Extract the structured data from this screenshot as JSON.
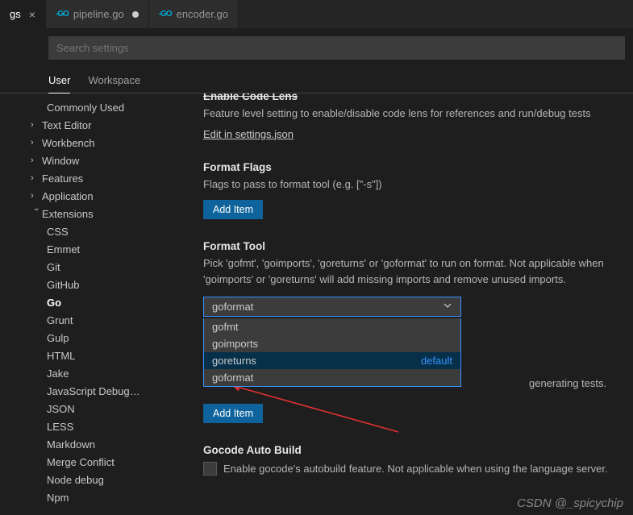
{
  "tabs": {
    "settings": "gs",
    "pipeline": "pipeline.go",
    "encoder": "encoder.go"
  },
  "search": {
    "placeholder": "Search settings"
  },
  "scope": {
    "user": "User",
    "workspace": "Workspace"
  },
  "sidebar": {
    "commonly_used": "Commonly Used",
    "text_editor": "Text Editor",
    "workbench": "Workbench",
    "window": "Window",
    "features": "Features",
    "application": "Application",
    "extensions": "Extensions",
    "items": [
      "CSS",
      "Emmet",
      "Git",
      "GitHub",
      "Go",
      "Grunt",
      "Gulp",
      "HTML",
      "Jake",
      "JavaScript Debug…",
      "JSON",
      "LESS",
      "Markdown",
      "Merge Conflict",
      "Node debug",
      "Npm"
    ]
  },
  "sections": {
    "code_lens": {
      "title": "Enable Code Lens",
      "desc": "Feature level setting to enable/disable code lens for references and run/debug tests",
      "edit_link": "Edit in settings.json"
    },
    "format_flags": {
      "title": "Format Flags",
      "desc": "Flags to pass to format tool (e.g. [\"-s\"])",
      "button": "Add Item"
    },
    "format_tool": {
      "title": "Format Tool",
      "desc": "Pick 'gofmt', 'goimports', 'goreturns' or 'goformat' to run on format. Not applicable when 'goimports' or 'goreturns' will add missing imports and remove unused imports.",
      "selected": "goformat",
      "options": {
        "gofmt": "gofmt",
        "goimports": "goimports",
        "goreturns": "goreturns",
        "goformat": "goformat"
      },
      "default_label": "default",
      "gen_tests_tail": "generating tests.",
      "button": "Add Item"
    },
    "gocode": {
      "title": "Gocode Auto Build",
      "desc": "Enable gocode's autobuild feature. Not applicable when using the language server."
    }
  },
  "watermark": "CSDN @_spicychip"
}
